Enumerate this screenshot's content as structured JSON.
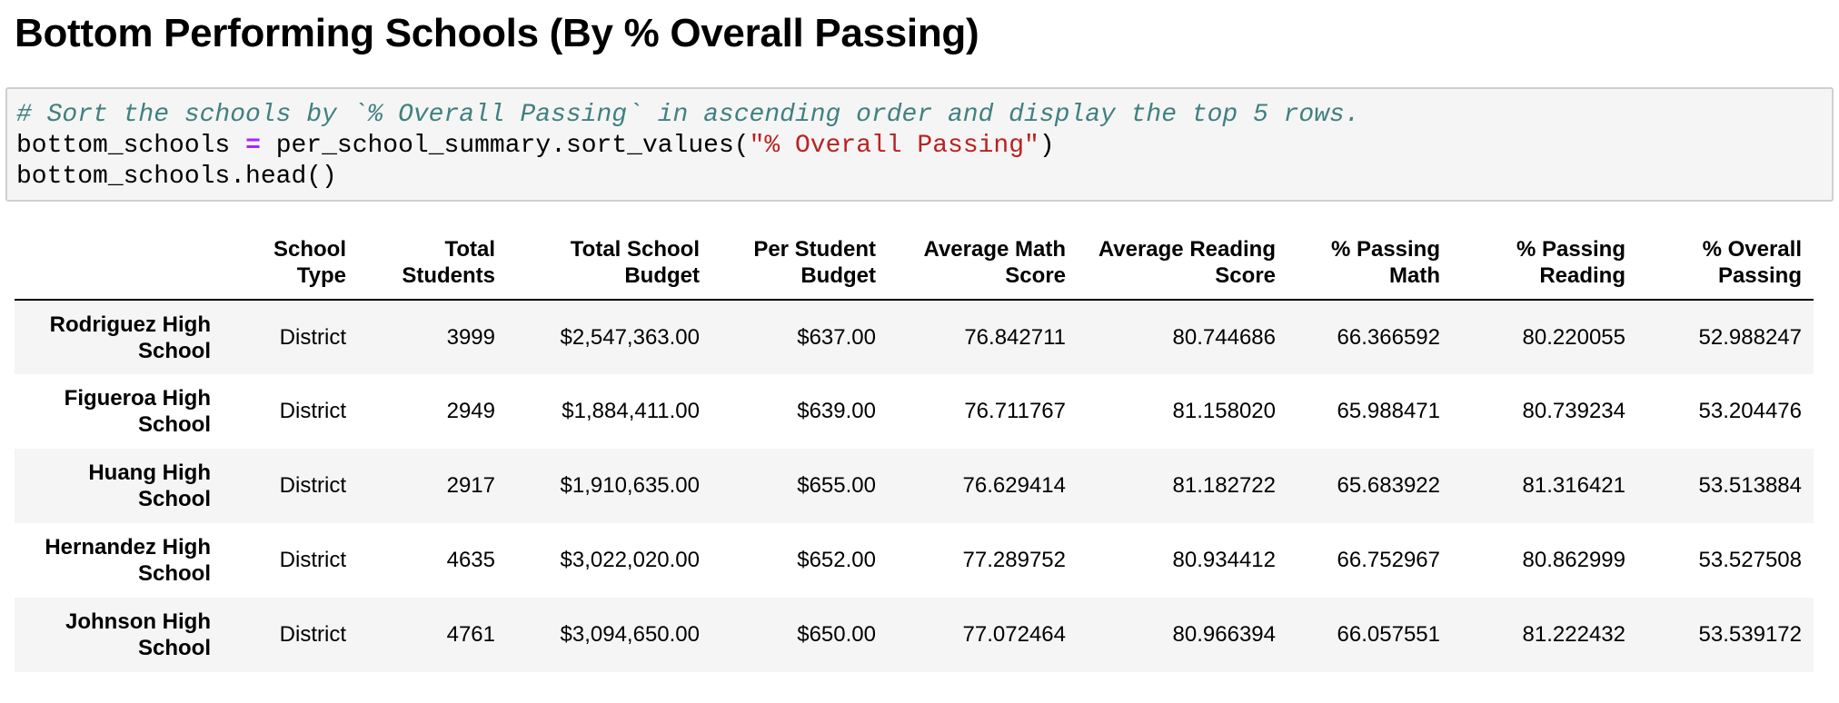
{
  "heading": "Bottom Performing Schools (By % Overall Passing)",
  "code": {
    "comment": "# Sort the schools by `% Overall Passing` in ascending order and display the top 5 rows.",
    "line2_var": "bottom_schools",
    "line2_op": "=",
    "line2_call_prefix": "per_school_summary.sort_values(",
    "line2_string": "\"% Overall Passing\"",
    "line2_call_suffix": ")",
    "line3": "bottom_schools.head()"
  },
  "table": {
    "columns": [
      "School Type",
      "Total Students",
      "Total School Budget",
      "Per Student Budget",
      "Average Math Score",
      "Average Reading Score",
      "% Passing Math",
      "% Passing Reading",
      "% Overall Passing"
    ],
    "rows": [
      {
        "index": "Rodriguez High School",
        "cells": [
          "District",
          "3999",
          "$2,547,363.00",
          "$637.00",
          "76.842711",
          "80.744686",
          "66.366592",
          "80.220055",
          "52.988247"
        ]
      },
      {
        "index": "Figueroa High School",
        "cells": [
          "District",
          "2949",
          "$1,884,411.00",
          "$639.00",
          "76.711767",
          "81.158020",
          "65.988471",
          "80.739234",
          "53.204476"
        ]
      },
      {
        "index": "Huang High School",
        "cells": [
          "District",
          "2917",
          "$1,910,635.00",
          "$655.00",
          "76.629414",
          "81.182722",
          "65.683922",
          "81.316421",
          "53.513884"
        ]
      },
      {
        "index": "Hernandez High School",
        "cells": [
          "District",
          "4635",
          "$3,022,020.00",
          "$652.00",
          "77.289752",
          "80.934412",
          "66.752967",
          "80.862999",
          "53.527508"
        ]
      },
      {
        "index": "Johnson High School",
        "cells": [
          "District",
          "4761",
          "$3,094,650.00",
          "$650.00",
          "77.072464",
          "80.966394",
          "66.057551",
          "81.222432",
          "53.539172"
        ]
      }
    ]
  }
}
